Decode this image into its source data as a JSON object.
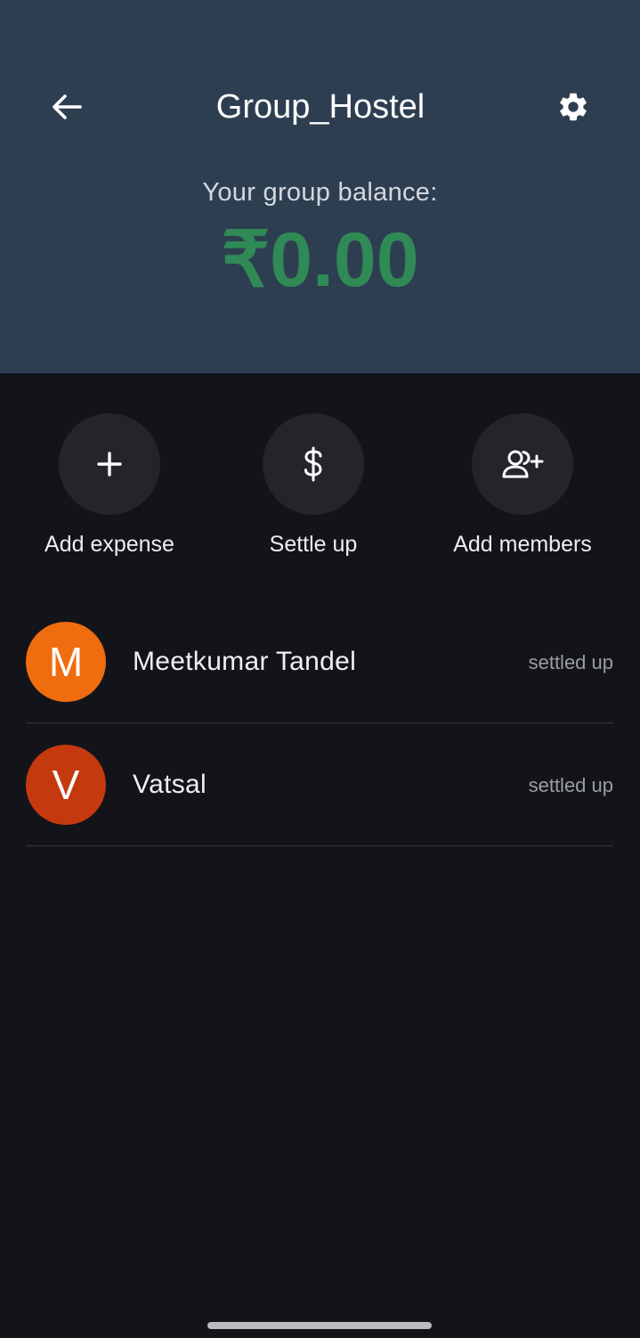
{
  "header": {
    "title": "Group_Hostel",
    "back_icon": "arrow-left-icon",
    "settings_icon": "gear-icon",
    "balance_label": "Your group balance:",
    "balance_value": "₹0.00",
    "background_color": "#2e3e51",
    "balance_color": "#2f8a55"
  },
  "actions": [
    {
      "label": "Add expense",
      "icon": "plus-icon"
    },
    {
      "label": "Settle up",
      "icon": "dollar-icon"
    },
    {
      "label": "Add members",
      "icon": "add-user-icon"
    }
  ],
  "members": [
    {
      "initial": "M",
      "name": "Meetkumar Tandel",
      "status": "settled up",
      "avatar_color": "#ef6c0f"
    },
    {
      "initial": "V",
      "name": "Vatsal",
      "status": "settled up",
      "avatar_color": "#c5390f"
    }
  ]
}
